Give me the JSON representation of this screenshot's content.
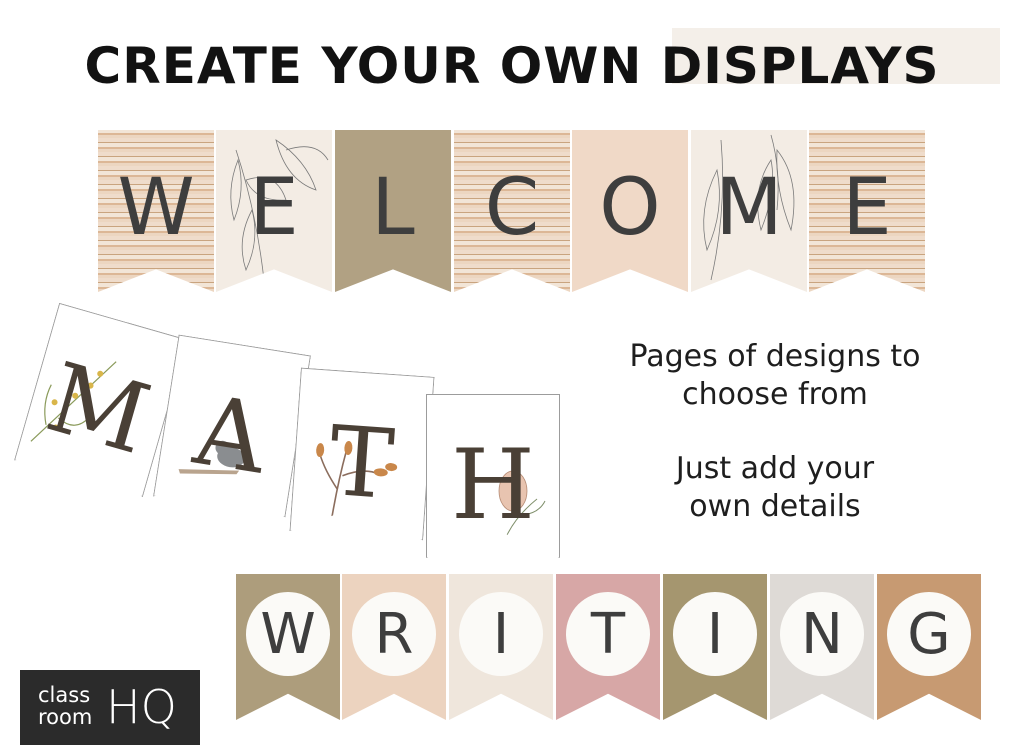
{
  "title": "CREATE YOUR OWN DISPLAYS",
  "welcome_letters": [
    "W",
    "E",
    "L",
    "C",
    "O",
    "M",
    "E"
  ],
  "math_letters": [
    "M",
    "A",
    "T",
    "H"
  ],
  "writing_letters": [
    "W",
    "R",
    "I",
    "T",
    "I",
    "N",
    "G"
  ],
  "side_text_1": [
    "Pages of designs to",
    "choose from"
  ],
  "side_text_2": [
    "Just add your",
    "own details"
  ],
  "logo": {
    "word1": "class",
    "word2": "room",
    "word3": "HQ"
  },
  "colors": {
    "title": "#121212",
    "letter": "#3e3e3e",
    "math_letter": "#4a4036",
    "logo_bg": "#2b2b2b",
    "highlight": "#f4efe9"
  }
}
